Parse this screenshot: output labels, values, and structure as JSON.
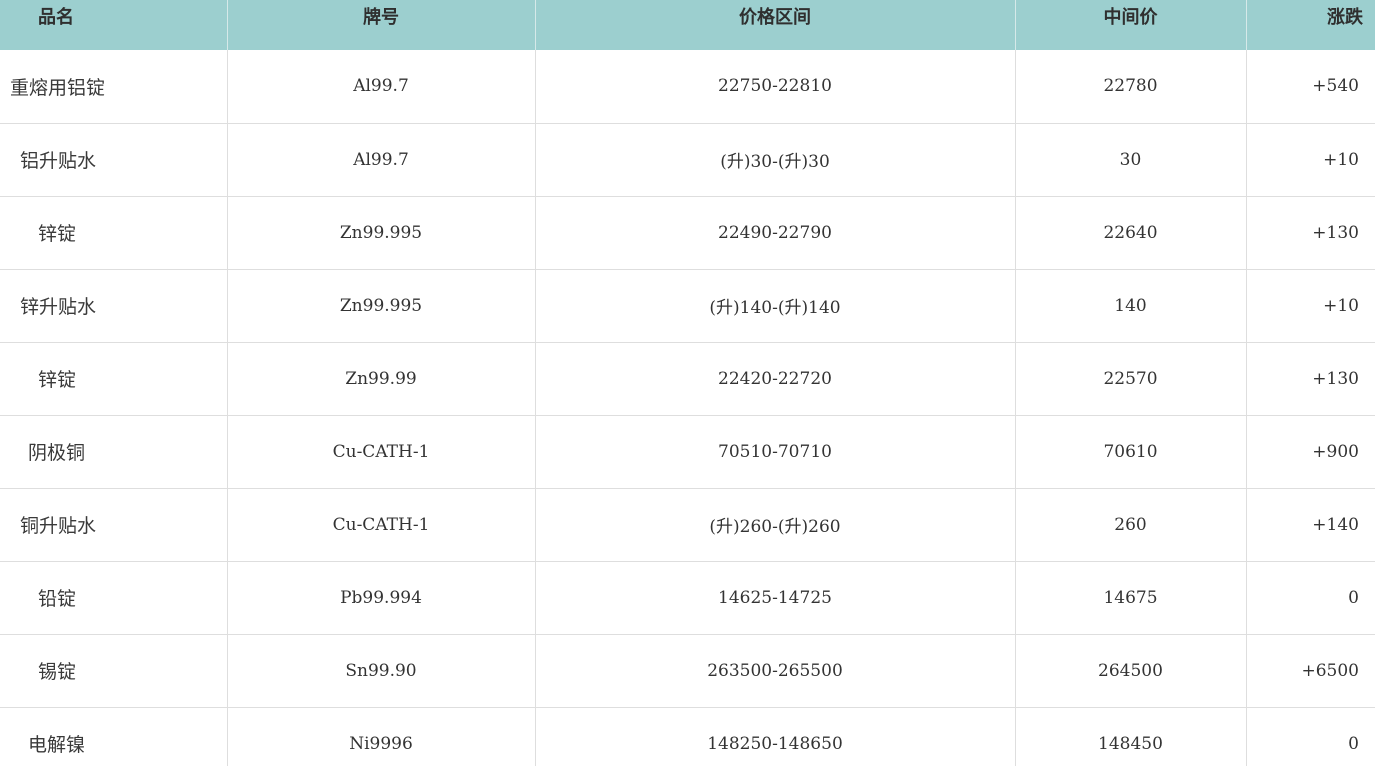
{
  "table": {
    "headers": [
      "品名",
      "牌号",
      "价格区间",
      "中间价",
      "涨跌"
    ],
    "rows": [
      [
        "重熔用铝锭",
        "Al99.7",
        "22750-22810",
        "22780",
        "+540"
      ],
      [
        "铝升贴水",
        "Al99.7",
        "(升)30-(升)30",
        "30",
        "+10"
      ],
      [
        "锌锭",
        "Zn99.995",
        "22490-22790",
        "22640",
        "+130"
      ],
      [
        "锌升贴水",
        "Zn99.995",
        "(升)140-(升)140",
        "140",
        "+10"
      ],
      [
        "锌锭",
        "Zn99.99",
        "22420-22720",
        "22570",
        "+130"
      ],
      [
        "阴极铜",
        "Cu-CATH-1",
        "70510-70710",
        "70610",
        "+900"
      ],
      [
        "铜升贴水",
        "Cu-CATH-1",
        "(升)260-(升)260",
        "260",
        "+140"
      ],
      [
        "铅锭",
        "Pb99.994",
        "14625-14725",
        "14675",
        "0"
      ],
      [
        "锡锭",
        "Sn99.90",
        "263500-265500",
        "264500",
        "+6500"
      ],
      [
        "电解镍",
        "Ni9996",
        "148250-148650",
        "148450",
        "0"
      ]
    ]
  },
  "colors": {
    "header_background": "#9ccfcf",
    "text": "#333333",
    "grid_line": "#dedede"
  }
}
